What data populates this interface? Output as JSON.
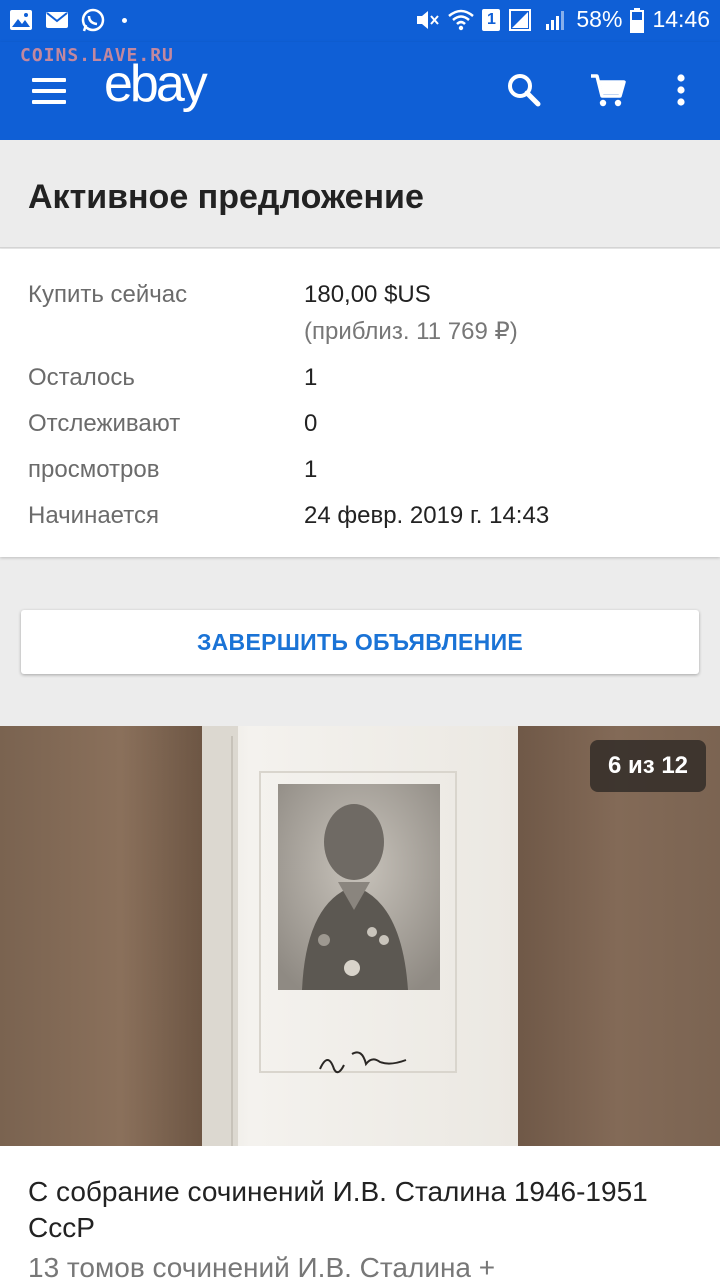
{
  "status_bar": {
    "icons_left": [
      "gallery-icon",
      "mail-icon",
      "whatsapp-icon"
    ],
    "battery": "58%",
    "time": "14:46",
    "sim_badge": "1"
  },
  "app_bar": {
    "watermark": "COINS.LAVE.RU",
    "logo": "ebay",
    "colors": {
      "bar": "#0f5fd6",
      "link": "#1a73d6"
    }
  },
  "section_title": "Активное предложение",
  "details": {
    "buy_now_label": "Купить сейчас",
    "buy_now_price": "180,00 $US",
    "buy_now_approx": "(приблиз. 11 769 ₽)",
    "remaining_label": "Осталось",
    "remaining_value": "1",
    "watching_label": "Отслеживают",
    "watching_value": "0",
    "views_label": "просмотров",
    "views_value": "1",
    "starts_label": "Начинается",
    "starts_value": "24 февр. 2019 г. 14:43"
  },
  "end_listing_button": "ЗАВЕРШИТЬ ОБЪЯВЛЕНИЕ",
  "gallery": {
    "counter": "6 из 12"
  },
  "item": {
    "title": "С собрание сочинений И.В. Сталина 1946-1951 СссР",
    "subtitle": "13 томов сочинений И.В. Сталина +"
  }
}
